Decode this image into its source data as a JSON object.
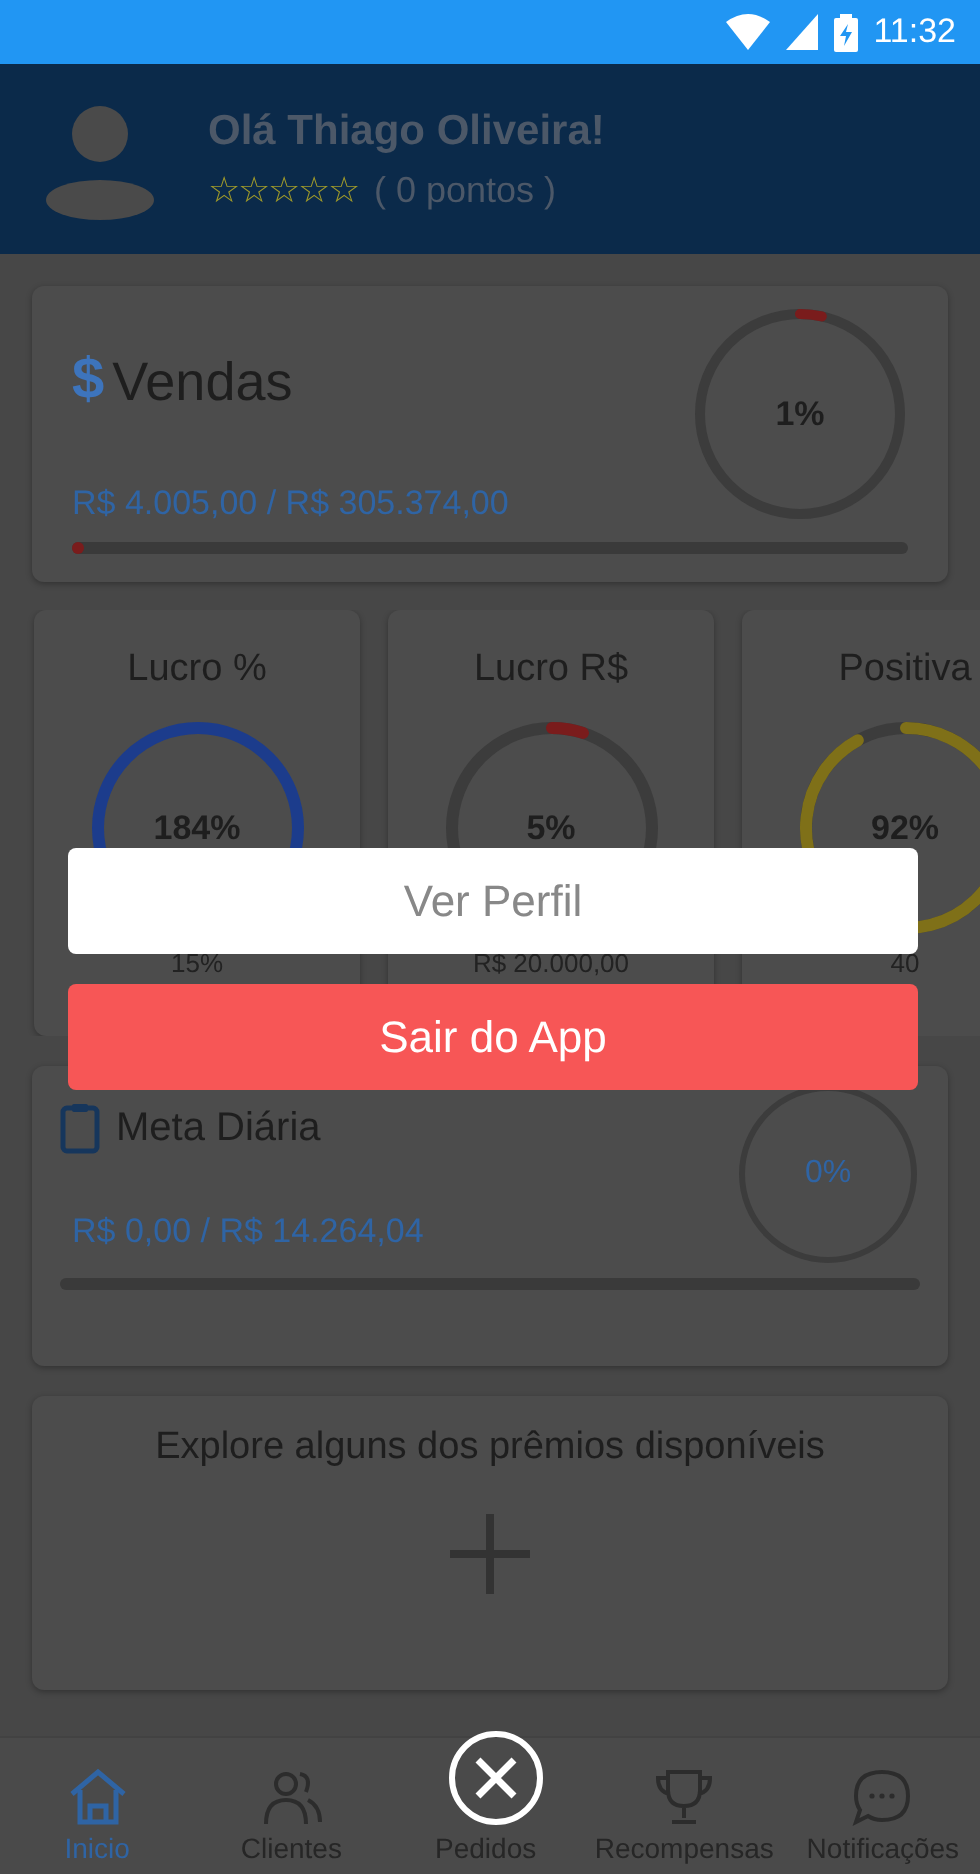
{
  "status_bar": {
    "time": "11:32"
  },
  "header": {
    "greeting": "Olá Thiago Oliveira!",
    "stars": 0,
    "points": "( 0 pontos )"
  },
  "sales_card": {
    "currency_icon": "$",
    "title": "Vendas",
    "ring": {
      "reading": "1%",
      "color": "#7a1c1c"
    },
    "amount": "R$ 4.005,00 /  R$ 305.374,00",
    "bar": {
      "level": 0.01
    }
  },
  "metric_cards": [
    {
      "title": "Lucro %",
      "reading": "184%",
      "color": "#1c3c8c",
      "footer": "15%"
    },
    {
      "title": "Lucro R$",
      "reading": "5%",
      "color": "#7a1c1c",
      "footer": "R$ 20.000,00"
    },
    {
      "title": "Positiva",
      "reading": "92%",
      "color": "#7f7018",
      "footer": "40"
    }
  ],
  "daily_goal": {
    "title": "Meta Diária",
    "ring": {
      "reading": "0%"
    },
    "amount": "R$ 0,00 /  R$ 14.264,04"
  },
  "explore": {
    "text": "Explore alguns dos prêmios disponíveis"
  },
  "nav": [
    {
      "label": "Inicio",
      "selected": true
    },
    {
      "label": "Clientes",
      "selected": false
    },
    {
      "label": "Pedidos",
      "selected": false
    },
    {
      "label": "Recompensas",
      "selected": false
    },
    {
      "label": "Notificações",
      "selected": false
    }
  ],
  "menu": {
    "buttons": [
      {
        "label": "Ver Perfil",
        "kind": "default"
      },
      {
        "label": "Sair do App",
        "kind": "danger"
      }
    ]
  }
}
